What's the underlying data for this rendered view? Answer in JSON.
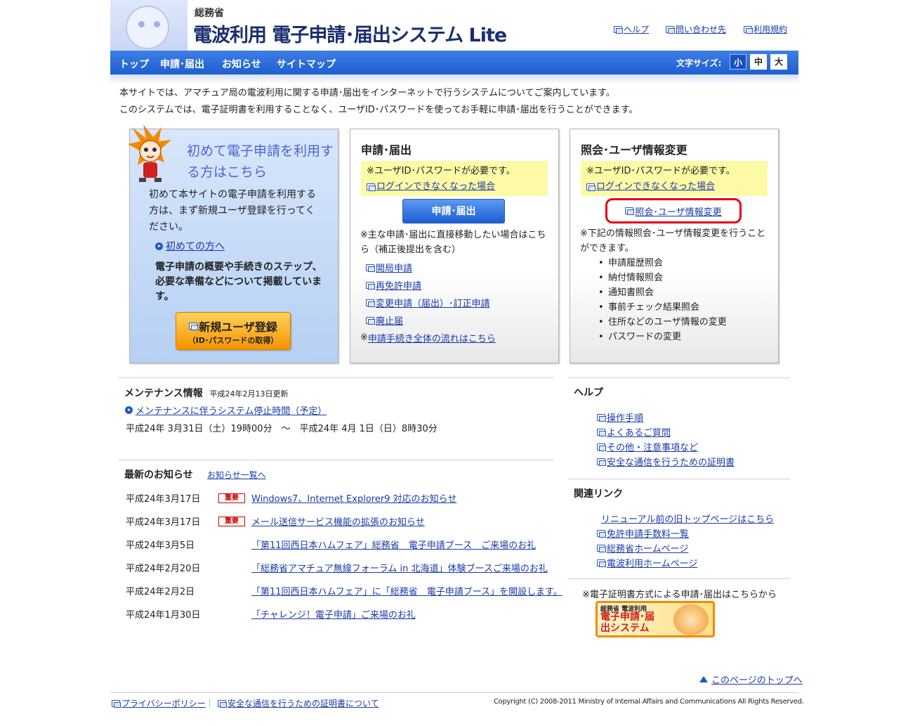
{
  "header": {
    "ministry": "総務省",
    "title": "電波利用 電子申請･届出システム Lite",
    "links": [
      "ヘルプ",
      "問い合わせ先",
      "利用規約"
    ]
  },
  "nav": {
    "items": [
      "トップ",
      "申請･届出",
      "お知らせ",
      "サイトマップ"
    ],
    "font_size_label": "文字サイズ:",
    "font_sizes": [
      "小",
      "中",
      "大"
    ],
    "selected_font_size": "小"
  },
  "intro": [
    "本サイトでは、アマチュア局の電波利用に関する申請･届出をインターネットで行うシステムについてご案内しています。",
    "このシステムでは、電子証明書を利用することなく、ユーザID･パスワードを使ってお手軽に申請･届出を行うことができます。"
  ],
  "panel_first": {
    "title": "初めて電子申請を利用する方はこちら",
    "desc": "初めて本サイトの電子申請を利用する方は、まず新規ユーザ登録を行ってください。",
    "link": "初めての方へ",
    "desc2": "電子申請の概要や手続きのステップ、必要な準備などについて掲載しています。",
    "register_label": "新規ユーザ登録",
    "register_sub": "（ID･パスワードの取得）"
  },
  "panel_apply": {
    "title": "申請･届出",
    "notice": "※ユーザID･パスワードが必要です。",
    "notice_link": "ログインできなくなった場合",
    "button": "申請･届出",
    "desc": "※主な申請･届出に直接移動したい場合はこちら（補正後提出を含む）",
    "links": [
      "開局申請",
      "再免許申請",
      "変更申請（届出）･訂正申請",
      "廃止届"
    ],
    "flow_prefix": "※",
    "flow_link": "申請手続き全体の流れはこちら"
  },
  "panel_inquiry": {
    "title": "照会･ユーザ情報変更",
    "notice": "※ユーザID･パスワードが必要です。",
    "notice_link": "ログインできなくなった場合",
    "button": "照会･ユーザ情報変更",
    "desc": "※下記の情報照会･ユーザ情報変更を行うことができます。",
    "items": [
      "申請履歴照会",
      "納付情報照会",
      "通知書照会",
      "事前チェック結果照会",
      "住所などのユーザ情報の変更",
      "パスワードの変更"
    ]
  },
  "maintenance": {
    "title": "メンテナンス情報",
    "updated": "平成24年2月13日更新",
    "link": "メンテナンスに伴うシステム停止時間（予定）",
    "period": "平成24年 3月31日（土）19時00分　～　平成24年 4月 1日（日）8時30分"
  },
  "news": {
    "title": "最新のお知らせ",
    "list_link": "お知らせ一覧へ",
    "badge": "重要",
    "items": [
      {
        "date": "平成24年3月17日",
        "important": true,
        "text": "Windows7、Internet Explorer9 対応のお知らせ"
      },
      {
        "date": "平成24年3月17日",
        "important": true,
        "text": "メール送信サービス機能の拡張のお知らせ"
      },
      {
        "date": "平成24年3月5日",
        "important": false,
        "text": "「第11回西日本ハムフェア」総務省　電子申請ブース　ご来場のお礼"
      },
      {
        "date": "平成24年2月20日",
        "important": false,
        "text": "「総務省アマチュア無線フォーラム in 北海道」体験ブースご来場のお礼"
      },
      {
        "date": "平成24年2月2日",
        "important": false,
        "text": "「第11回西日本ハムフェア」に「総務省　電子申請ブース」を開設します。"
      },
      {
        "date": "平成24年1月30日",
        "important": false,
        "text": "「チャレンジ！電子申請」ご来場のお礼"
      }
    ]
  },
  "help": {
    "title": "ヘルプ",
    "links": [
      "操作手順",
      "よくあるご質問",
      "その他・注意事項など",
      "安全な通信を行うための証明書"
    ]
  },
  "related": {
    "title": "関連リンク",
    "old_top": "リニューアル前の旧トップページはこちら",
    "links": [
      "免許申請手数料一覧",
      "総務省ホームページ",
      "電波利用ホームページ"
    ]
  },
  "cert_note": "※電子証明書方式による申請･届出はこちらから",
  "banner": {
    "line1": "総務省 電波利用",
    "line2": "電子申請･届出システム"
  },
  "footer": {
    "page_top": "このページのトップへ",
    "privacy": "プライバシーポリシー",
    "cert": "安全な通信を行うための証明書について",
    "copyright": "Copyright (C) 2008-2011 Ministry of Internal Affairs and Communications All Rights Reserved."
  },
  "colors": {
    "nav_blue": "#2a6ddb",
    "highlight_red": "#e60012",
    "notice_yellow": "#fdfaa5",
    "register_orange": "#f39400"
  }
}
